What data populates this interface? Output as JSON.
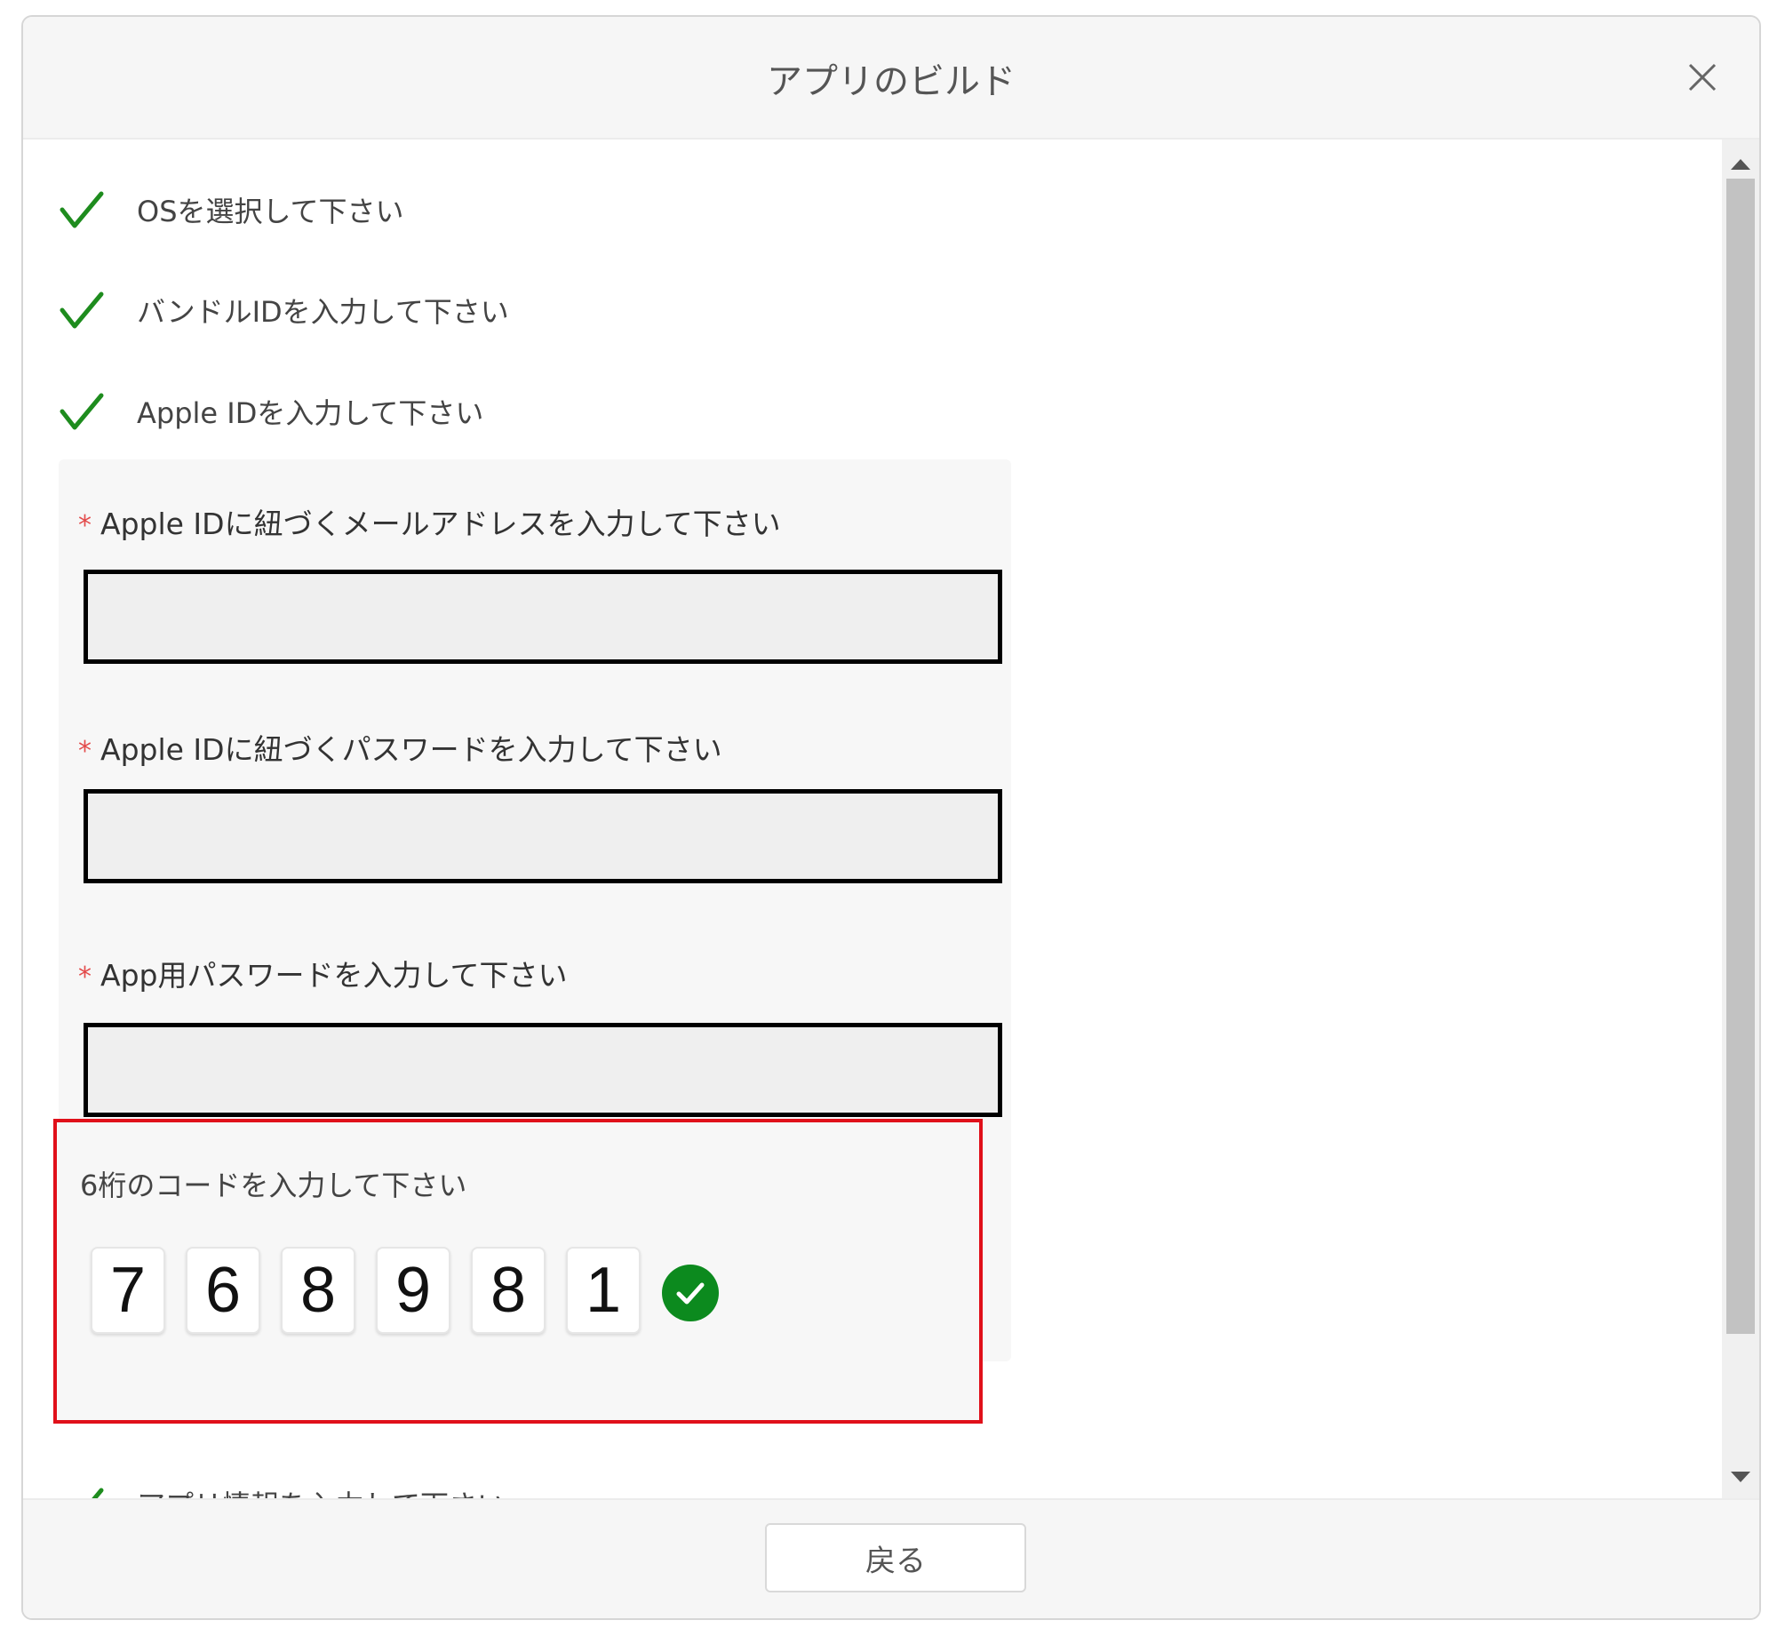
{
  "dialog": {
    "title": "アプリのビルド",
    "close_icon": "close-icon"
  },
  "steps": [
    {
      "label": "OSを選択して下さい",
      "status": "done"
    },
    {
      "label": "バンドルIDを入力して下さい",
      "status": "done"
    },
    {
      "label": "Apple IDを入力して下さい",
      "status": "done"
    }
  ],
  "form": {
    "required_mark": "*",
    "email_label": "Apple IDに紐づくメールアドレスを入力して下さい",
    "email_value": "",
    "password_label": "Apple IDに紐づくパスワードを入力して下さい",
    "password_value": "",
    "app_password_label": "App用パスワードを入力して下さい",
    "app_password_value": ""
  },
  "code": {
    "label": "6桁のコードを入力して下さい",
    "digits": [
      "7",
      "6",
      "8",
      "9",
      "8",
      "1"
    ],
    "verified_icon": "check-circle-icon"
  },
  "next_step": {
    "label": "アプリ情報を入力して下さい"
  },
  "footer": {
    "back_label": "戻る"
  },
  "colors": {
    "check_green": "#1e8c1e",
    "required_red": "#e34b4b",
    "highlight_red": "#e0101a",
    "verified_green": "#0c8a1e"
  }
}
